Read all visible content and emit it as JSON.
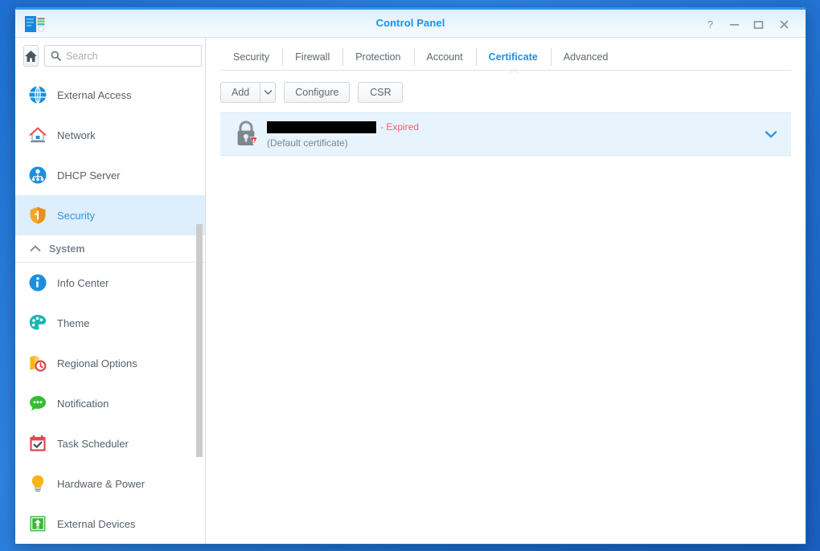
{
  "window": {
    "title": "Control Panel",
    "app_icon": "control-panel-icon",
    "controls": [
      {
        "name": "help-button",
        "glyph": "?"
      },
      {
        "name": "minimize-button",
        "glyph": "–"
      },
      {
        "name": "maximize-button",
        "glyph": "□"
      },
      {
        "name": "close-button",
        "glyph": "✕"
      }
    ]
  },
  "sidebar": {
    "home_icon": "home-icon",
    "search": {
      "placeholder": "Search",
      "value": "",
      "icon": "search-icon"
    },
    "items": [
      {
        "label": "External Access",
        "icon": "globe-icon",
        "selected": false
      },
      {
        "label": "Network",
        "icon": "house-network-icon",
        "selected": false
      },
      {
        "label": "DHCP Server",
        "icon": "dhcp-nodes-icon",
        "selected": false
      },
      {
        "label": "Security",
        "icon": "shield-icon",
        "selected": true
      }
    ],
    "group": {
      "label": "System",
      "collapse_icon": "chevron-up-icon"
    },
    "system_items": [
      {
        "label": "Info Center",
        "icon": "info-circle-icon"
      },
      {
        "label": "Theme",
        "icon": "palette-icon"
      },
      {
        "label": "Regional Options",
        "icon": "map-clock-icon"
      },
      {
        "label": "Notification",
        "icon": "speech-bubble-icon"
      },
      {
        "label": "Task Scheduler",
        "icon": "calendar-check-icon"
      },
      {
        "label": "Hardware & Power",
        "icon": "lightbulb-icon"
      },
      {
        "label": "External Devices",
        "icon": "usb-upload-icon"
      }
    ],
    "scrollbar": "vertical-scrollbar"
  },
  "main": {
    "tabs": [
      {
        "label": "Security",
        "active": false
      },
      {
        "label": "Firewall",
        "active": false
      },
      {
        "label": "Protection",
        "active": false
      },
      {
        "label": "Account",
        "active": false
      },
      {
        "label": "Certificate",
        "active": true
      },
      {
        "label": "Advanced",
        "active": false
      }
    ],
    "toolbar": {
      "add_label": "Add",
      "add_arrow_icon": "caret-down-icon",
      "configure_label": "Configure",
      "csr_label": "CSR"
    },
    "certificate": {
      "lock_icon": "lock-warning-icon",
      "name_redacted": true,
      "name": "",
      "status": "- Expired",
      "subtitle": "(Default certificate)",
      "expand_icon": "chevron-down-icon"
    }
  },
  "colors": {
    "accent_blue": "#1e90e8",
    "selected_row": "#ddeefc",
    "panel_blue": "#e8f4fd",
    "status_red": "#f4616b",
    "text_gray": "#57616b",
    "desktop_blue": "#2d83e0"
  }
}
